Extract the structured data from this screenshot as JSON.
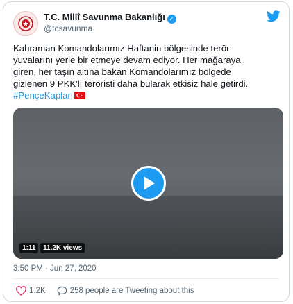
{
  "tweet": {
    "author_name": "T.C. Millî Savunma Bakanlığı",
    "author_handle": "@tcsavunma",
    "text_line1": "Kahraman Komandolarımız Haftanin bölgesinde terör",
    "text_line2": "yuvalarını yerle bir etmeye devam ediyor. Her mağaraya",
    "text_line3": "giren, her taşın altına bakan Komandolarımız bölgede",
    "text_line4": "gizlenen 9 PKK'lı teröristi daha bularak etkisiz hale getirdi.",
    "hashtag": "#PençeKaplan",
    "flag_icon": "turkey-flag-icon",
    "timestamp": "3:50 PM · Jun 27, 2020"
  },
  "video": {
    "duration": "1:11",
    "views": "11.2K views",
    "play_icon": "play-icon"
  },
  "actions": {
    "likes": "1.2K",
    "tweeting_text": "258 people are Tweeting about this"
  },
  "colors": {
    "accent": "#1d9bf0",
    "hashtag": "#1b95e0",
    "muted": "#536471",
    "like_red": "#e0245e"
  }
}
